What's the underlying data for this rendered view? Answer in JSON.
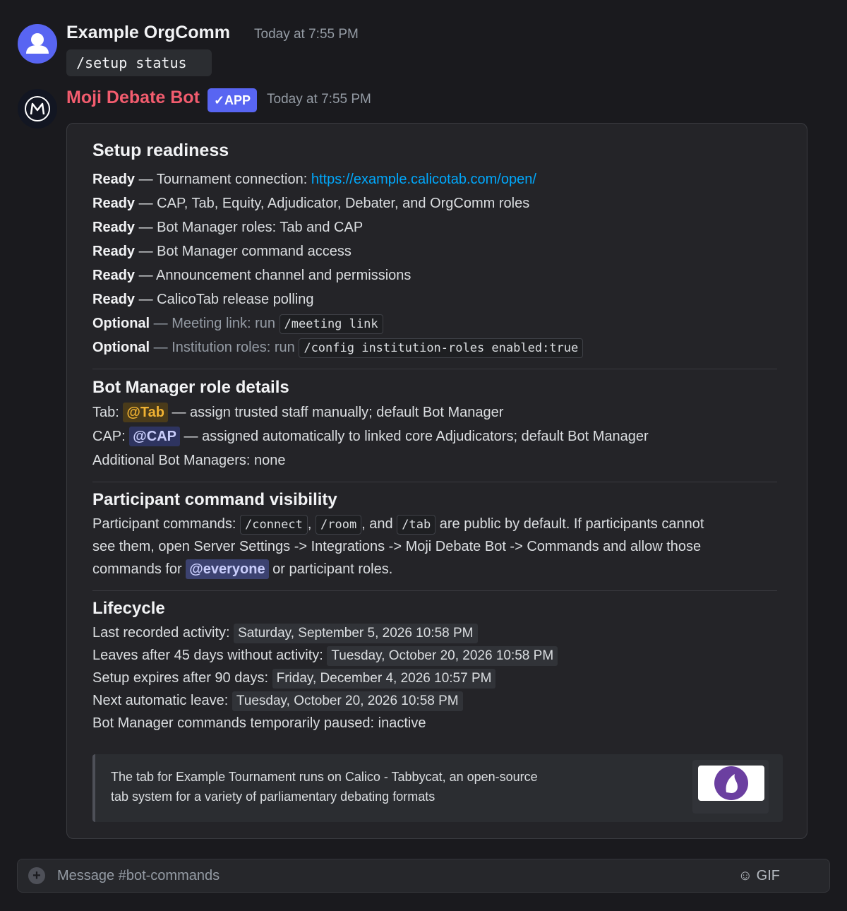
{
  "message1": {
    "username": "Example OrgComm",
    "timestamp": "Today at 7:55 PM",
    "command": "/setup status"
  },
  "message2": {
    "username": "Moji Debate Bot",
    "username_color": "#f25c6e",
    "badge": "✓APP",
    "timestamp": "Today at 7:55 PM"
  },
  "embed": {
    "readiness_title": "Setup readiness",
    "readiness": [
      {
        "status": "Ready",
        "sep": " — ",
        "text": "Tournament connection: ",
        "link": "https://example.calicotab.com/open/"
      },
      {
        "status": "Ready",
        "sep": " — ",
        "text": "CAP, Tab, Equity, Adjudicator, Debater, and OrgComm roles"
      },
      {
        "status": "Ready",
        "sep": " — ",
        "text": "Bot Manager roles: Tab and CAP"
      },
      {
        "status": "Ready",
        "sep": " — ",
        "text": "Bot Manager command access"
      },
      {
        "status": "Ready",
        "sep": " — ",
        "text": "Announcement channel and permissions"
      },
      {
        "status": "Ready",
        "sep": " — ",
        "text": "CalicoTab release polling"
      },
      {
        "status": "Optional",
        "sep": " — ",
        "text": "Meeting link: run ",
        "code": "/meeting link"
      },
      {
        "status": "Optional",
        "sep": " — ",
        "text": "Institution roles: run ",
        "code": "/config institution-roles enabled:true"
      }
    ],
    "roles_title": "Bot Manager role details",
    "roles": {
      "tab_label": "Tab: ",
      "tab_mention": "@Tab",
      "tab_text": " — assign trusted staff manually; default Bot Manager",
      "cap_label": "CAP: ",
      "cap_mention": "@CAP",
      "cap_text": " — assigned automatically to linked core Adjudicators; default Bot Manager",
      "additional": "Additional Bot Managers: none"
    },
    "visibility_title": "Participant command visibility",
    "visibility": {
      "intro": "Participant commands: ",
      "cmd1": "/connect",
      "sep1": ", ",
      "cmd2": "/room",
      "sep2": ", and ",
      "cmd3": "/tab",
      "line1_rest": " are public by default. If participants cannot",
      "line2": "see them, open Server Settings -> Integrations -> Moji Debate Bot -> Commands and allow those",
      "line3_pre": "commands for ",
      "mention": "@everyone",
      "line3_post": " or participant roles."
    },
    "lifecycle_title": "Lifecycle",
    "lifecycle": [
      {
        "label": "Last recorded activity: ",
        "date": "Saturday, September 5, 2026 10:58 PM"
      },
      {
        "label": "Leaves after 45 days without activity: ",
        "date": "Tuesday, October 20, 2026 10:58 PM"
      },
      {
        "label": "Setup expires after 90 days: ",
        "date": "Friday, December 4, 2026 10:57 PM"
      },
      {
        "label": "Next automatic leave: ",
        "date": "Tuesday, October 20, 2026 10:58 PM"
      },
      {
        "label": "Bot Manager commands temporarily paused: inactive"
      }
    ],
    "link_preview": {
      "line1": "The tab for Example Tournament runs on Calico - Tabbycat, an open-source",
      "line2": "tab system for a variety of parliamentary debating formats"
    }
  },
  "composer": {
    "plus_icon": "+",
    "placeholder": "Message #bot-commands",
    "emoji_icon": "☺",
    "gif_label": "GIF"
  }
}
